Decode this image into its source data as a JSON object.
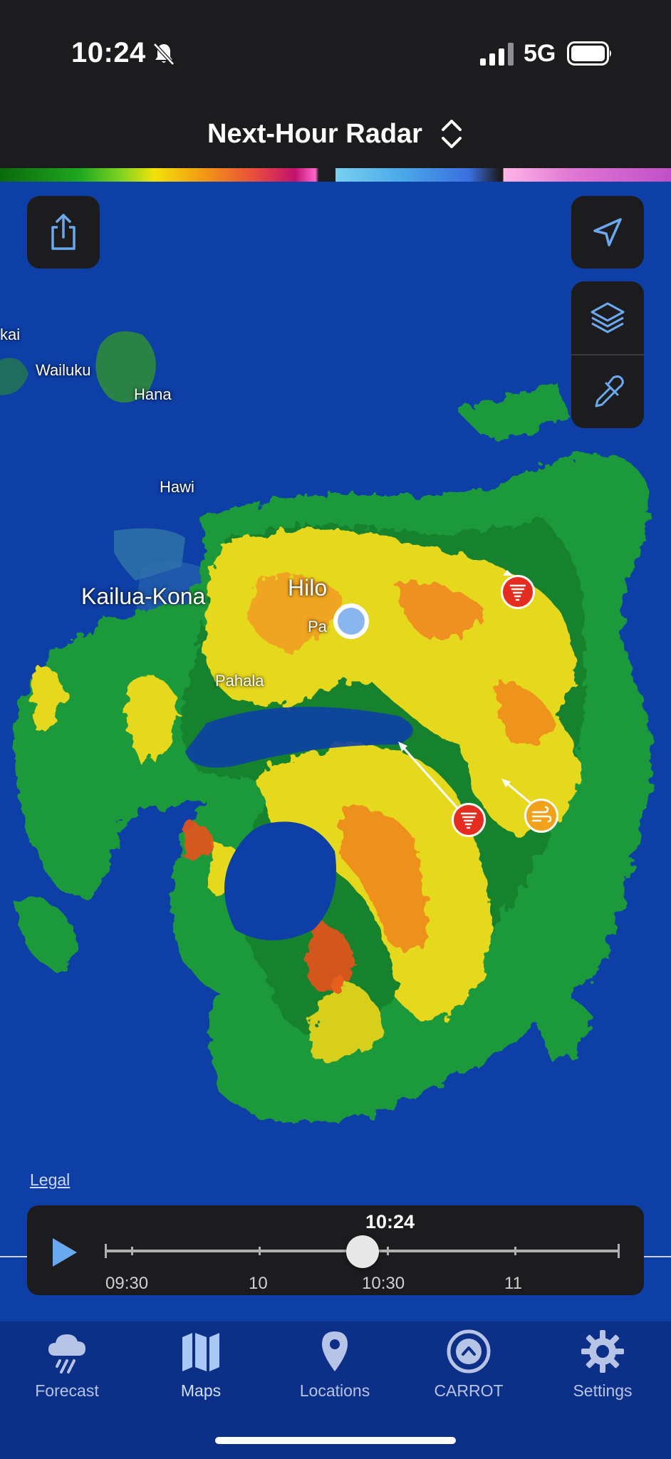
{
  "status_bar": {
    "time": "10:24",
    "network": "5G",
    "icons": [
      "bell-slash-icon",
      "signal-icon",
      "battery-icon"
    ]
  },
  "header": {
    "title": "Next-Hour Radar",
    "icon": "chevron-updown-icon"
  },
  "map": {
    "buttons": [
      "share-icon",
      "location-arrow-icon",
      "layers-icon",
      "eyedropper-icon"
    ],
    "cities": {
      "kai": "kai",
      "wailuku": "Wailuku",
      "hana": "Hana",
      "hawi": "Hawi",
      "kailua_kona": "Kailua-Kona",
      "hilo": "Hilo",
      "pahala": "Pahala",
      "pa": "Pa"
    },
    "legal": "Legal",
    "markers": [
      "tornado-marker-icon",
      "tornado-marker-icon",
      "wind-marker-icon"
    ],
    "colors": {
      "water": "#0d3fa6",
      "light_rain": "#1e9a3a",
      "moderate_rain": "#f0d81a",
      "heavy_rain": "#e8531e"
    }
  },
  "timeline": {
    "current": "10:24",
    "ticks": [
      "09:30",
      "10",
      "10:30",
      "11"
    ],
    "progress": 0.5
  },
  "tabs": [
    {
      "label": "Forecast",
      "icon": "cloud-rain-icon"
    },
    {
      "label": "Maps",
      "icon": "map-icon"
    },
    {
      "label": "Locations",
      "icon": "location-pin-icon"
    },
    {
      "label": "CARROT",
      "icon": "carrot-icon"
    },
    {
      "label": "Settings",
      "icon": "gear-icon"
    }
  ],
  "colors": {
    "accent": "#5aa0ff",
    "tab_bar": "#0c2f88",
    "tornado_red": "#e52d1f",
    "wind_orange": "#f2a11a"
  }
}
